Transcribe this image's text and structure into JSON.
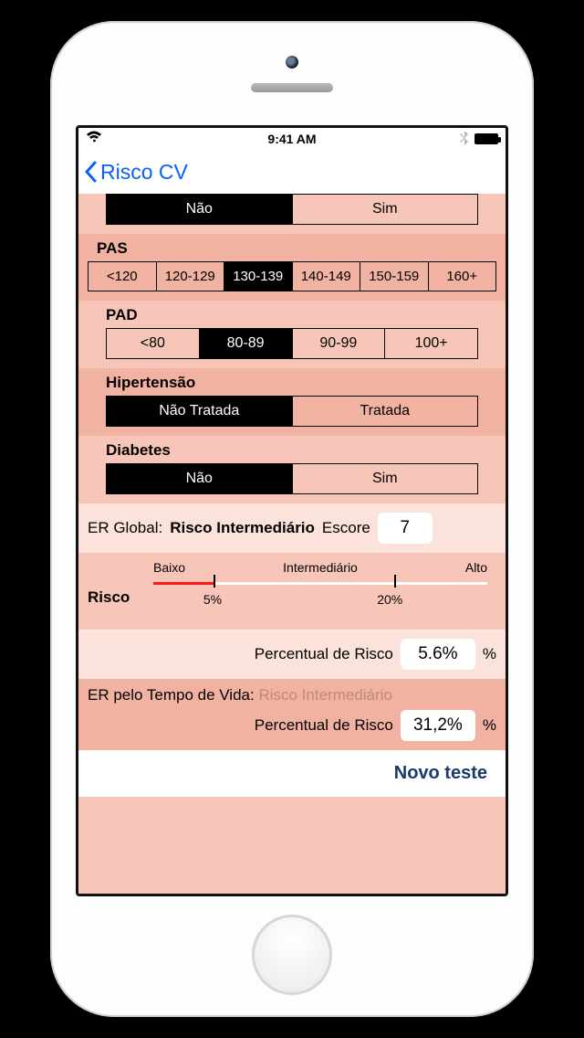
{
  "statusbar": {
    "time": "9:41 AM"
  },
  "nav": {
    "back_title": "Risco CV"
  },
  "segments": {
    "top": {
      "options": [
        "Não",
        "Sim"
      ],
      "selected": 0
    },
    "pas": {
      "label": "PAS",
      "options": [
        "<120",
        "120-129",
        "130-139",
        "140-149",
        "150-159",
        "160+"
      ],
      "selected": 2
    },
    "pad": {
      "label": "PAD",
      "options": [
        "<80",
        "80-89",
        "90-99",
        "100+"
      ],
      "selected": 1
    },
    "hipertensao": {
      "label": "Hipertensão",
      "options": [
        "Não Tratada",
        "Tratada"
      ],
      "selected": 0
    },
    "diabetes": {
      "label": "Diabetes",
      "options": [
        "Não",
        "Sim"
      ],
      "selected": 0
    }
  },
  "er_global": {
    "label": "ER Global:",
    "value_text": "Risco Intermediário",
    "score_label": "Escore",
    "score": "7"
  },
  "risk_scale": {
    "side_label": "Risco",
    "cats": [
      "Baixo",
      "Intermediário",
      "Alto"
    ],
    "ticks_pct": [
      18,
      72
    ],
    "pct_labels": [
      "5%",
      "20%"
    ],
    "filled_pct": 18
  },
  "percent_risk": {
    "label": "Percentual de Risco",
    "value": "5.6%",
    "unit": "%"
  },
  "lifetime": {
    "label": "ER pelo Tempo de Vida:",
    "value_text": "Risco Intermediário",
    "percent_label": "Percentual de Risco",
    "percent_value": "31,2%",
    "unit": "%"
  },
  "footer": {
    "new_test": "Novo teste"
  }
}
